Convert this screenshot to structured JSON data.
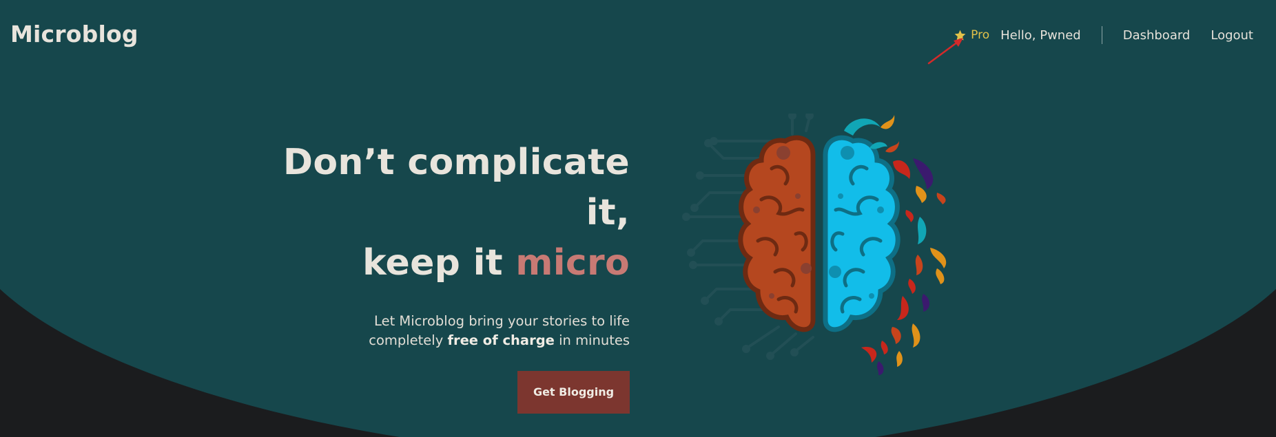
{
  "brand": {
    "name": "Microblog"
  },
  "nav": {
    "pro_label": "Pro",
    "greeting": "Hello, Pwned",
    "dashboard_label": "Dashboard",
    "logout_label": "Logout"
  },
  "hero": {
    "headline_line1": "Don’t complicate it,",
    "headline_line2_prefix": "keep it ",
    "headline_line2_accent": "micro",
    "subtitle_line1": "Let Microblog bring your stories to life",
    "subtitle_line2_prefix": "completely ",
    "subtitle_line2_bold": "free of charge",
    "subtitle_line2_suffix": " in minutes",
    "cta_label": "Get Blogging"
  },
  "colors": {
    "hero_bg": "#16474c",
    "page_bg": "#1b1c1e",
    "accent": "#c87a74",
    "cta_bg": "#7c362f",
    "pro": "#e2c24a",
    "annotation_arrow": "#d42a2a"
  },
  "icons": {
    "pro": "star-icon",
    "annotation": "red-arrow-icon",
    "illustration": "brain-illustration"
  }
}
